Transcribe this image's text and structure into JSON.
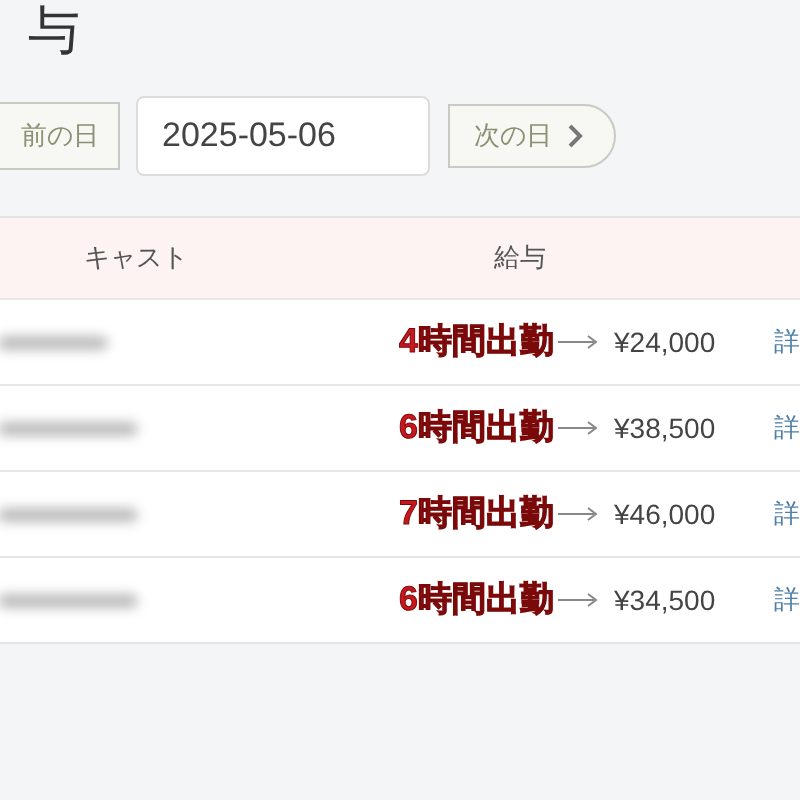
{
  "page_title": "与",
  "date_nav": {
    "prev_label": "前の日",
    "date": "2025-05-06",
    "next_label": "次の日"
  },
  "table": {
    "columns": [
      "キャスト",
      "給与"
    ],
    "rows": [
      {
        "note": "4時間出勤",
        "salary": "¥24,000",
        "link": "詳"
      },
      {
        "note": "6時間出勤",
        "salary": "¥38,500",
        "link": "詳"
      },
      {
        "note": "7時間出勤",
        "salary": "¥46,000",
        "link": "詳"
      },
      {
        "note": "6時間出勤",
        "salary": "¥34,500",
        "link": "詳"
      }
    ]
  }
}
